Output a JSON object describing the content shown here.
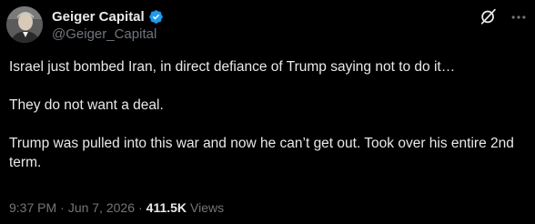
{
  "author": {
    "display_name": "Geiger Capital",
    "handle": "@Geiger_Capital",
    "verified": true,
    "verified_color": "#1d9bf0",
    "avatar_icon": "profile-photo"
  },
  "actions": {
    "grok_icon": "grok-icon",
    "more_icon": "more-horizontal-icon"
  },
  "post": {
    "paragraphs": [
      "Israel just bombed Iran, in direct defiance of Trump saying not to do it…",
      "They do not want a deal.",
      "Trump was pulled into this war and now he can’t get out. Took over his entire 2nd term."
    ]
  },
  "meta": {
    "time": "9:37 PM",
    "separator": "·",
    "date": "Jun 7, 2026",
    "views_count": "411.5K",
    "views_label": "Views"
  },
  "colors": {
    "background": "#000000",
    "text_primary": "#e7e9ea",
    "text_secondary": "#71767b"
  }
}
